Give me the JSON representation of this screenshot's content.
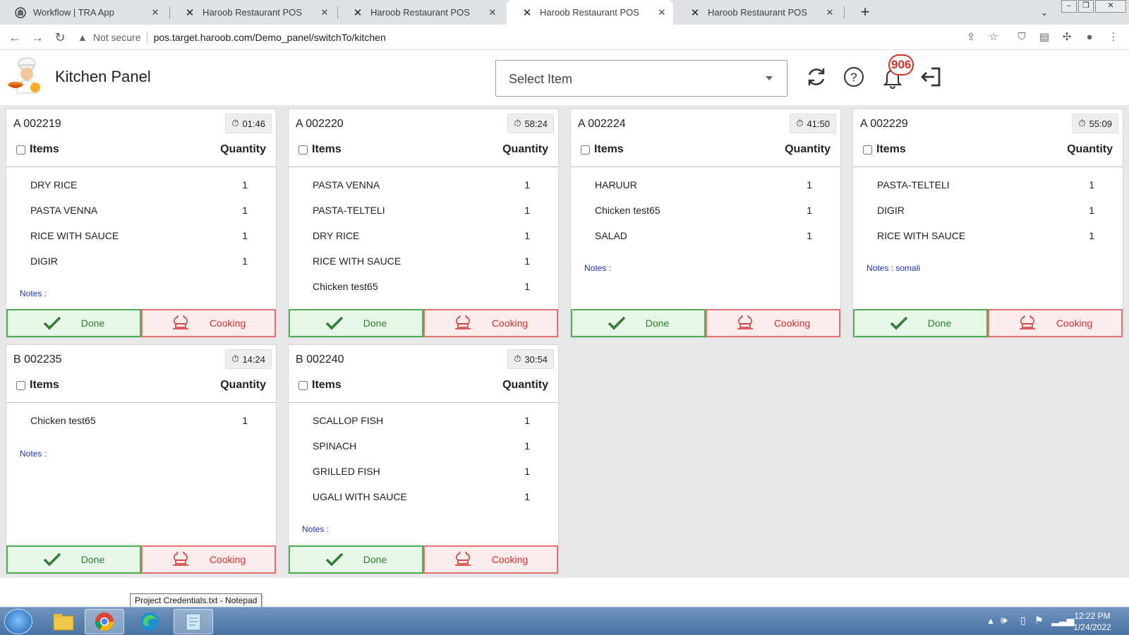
{
  "browser": {
    "tabs": [
      {
        "title": "Workflow | TRA App",
        "active": false
      },
      {
        "title": "Haroob Restaurant POS",
        "active": false
      },
      {
        "title": "Haroob Restaurant POS",
        "active": false
      },
      {
        "title": "Haroob Restaurant POS",
        "active": true
      },
      {
        "title": "Haroob Restaurant POS",
        "active": false
      }
    ],
    "security_label": "Not secure",
    "url": "pos.target.haroob.com/Demo_panel/switchTo/kitchen"
  },
  "app": {
    "title": "Kitchen Panel",
    "select_placeholder": "Select Item",
    "notification_count": "906"
  },
  "orders": [
    {
      "id": "A 002219",
      "timer": "01:46",
      "items_label": "Items",
      "qty_label": "Quantity",
      "items": [
        {
          "name": "DRY RICE",
          "qty": "1"
        },
        {
          "name": "PASTA VENNA",
          "qty": "1"
        },
        {
          "name": "RICE WITH SAUCE",
          "qty": "1"
        },
        {
          "name": "DIGIR",
          "qty": "1"
        }
      ],
      "notes": "Notes :",
      "done_label": "Done",
      "cooking_label": "Cooking"
    },
    {
      "id": "A 002220",
      "timer": "58:24",
      "items_label": "Items",
      "qty_label": "Quantity",
      "items": [
        {
          "name": "PASTA VENNA",
          "qty": "1"
        },
        {
          "name": "PASTA-TELTELI",
          "qty": "1"
        },
        {
          "name": "DRY RICE",
          "qty": "1"
        },
        {
          "name": "RICE WITH SAUCE",
          "qty": "1"
        },
        {
          "name": "Chicken test65",
          "qty": "1"
        }
      ],
      "notes": "",
      "done_label": "Done",
      "cooking_label": "Cooking"
    },
    {
      "id": "A 002224",
      "timer": "41:50",
      "items_label": "Items",
      "qty_label": "Quantity",
      "items": [
        {
          "name": "HARUUR",
          "qty": "1"
        },
        {
          "name": "Chicken test65",
          "qty": "1"
        },
        {
          "name": "SALAD",
          "qty": "1"
        }
      ],
      "notes": "Notes :",
      "done_label": "Done",
      "cooking_label": "Cooking"
    },
    {
      "id": "A 002229",
      "timer": "55:09",
      "items_label": "Items",
      "qty_label": "Quantity",
      "items": [
        {
          "name": "PASTA-TELTELI",
          "qty": "1"
        },
        {
          "name": "DIGIR",
          "qty": "1"
        },
        {
          "name": "RICE WITH SAUCE",
          "qty": "1"
        }
      ],
      "notes": "Notes : somali",
      "done_label": "Done",
      "cooking_label": "Cooking"
    },
    {
      "id": "B 002235",
      "timer": "14:24",
      "items_label": "Items",
      "qty_label": "Quantity",
      "items": [
        {
          "name": "Chicken test65",
          "qty": "1"
        }
      ],
      "notes": "Notes :",
      "done_label": "Done",
      "cooking_label": "Cooking"
    },
    {
      "id": "B 002240",
      "timer": "30:54",
      "items_label": "Items",
      "qty_label": "Quantity",
      "items": [
        {
          "name": "SCALLOP FISH",
          "qty": "1"
        },
        {
          "name": "SPINACH",
          "qty": "1"
        },
        {
          "name": "GRILLED FISH",
          "qty": "1"
        },
        {
          "name": "UGALI WITH SAUCE",
          "qty": "1"
        }
      ],
      "notes": "Notes :",
      "done_label": "Done",
      "cooking_label": "Cooking"
    }
  ],
  "taskbar": {
    "tooltip": "Project Credentials.txt - Notepad",
    "time": "12:22 PM",
    "date": "1/24/2022"
  },
  "colors": {
    "done_border": "#4caf50",
    "cooking_border": "#e57373",
    "notes_text": "#1a33b8",
    "notification": "#d93025"
  }
}
